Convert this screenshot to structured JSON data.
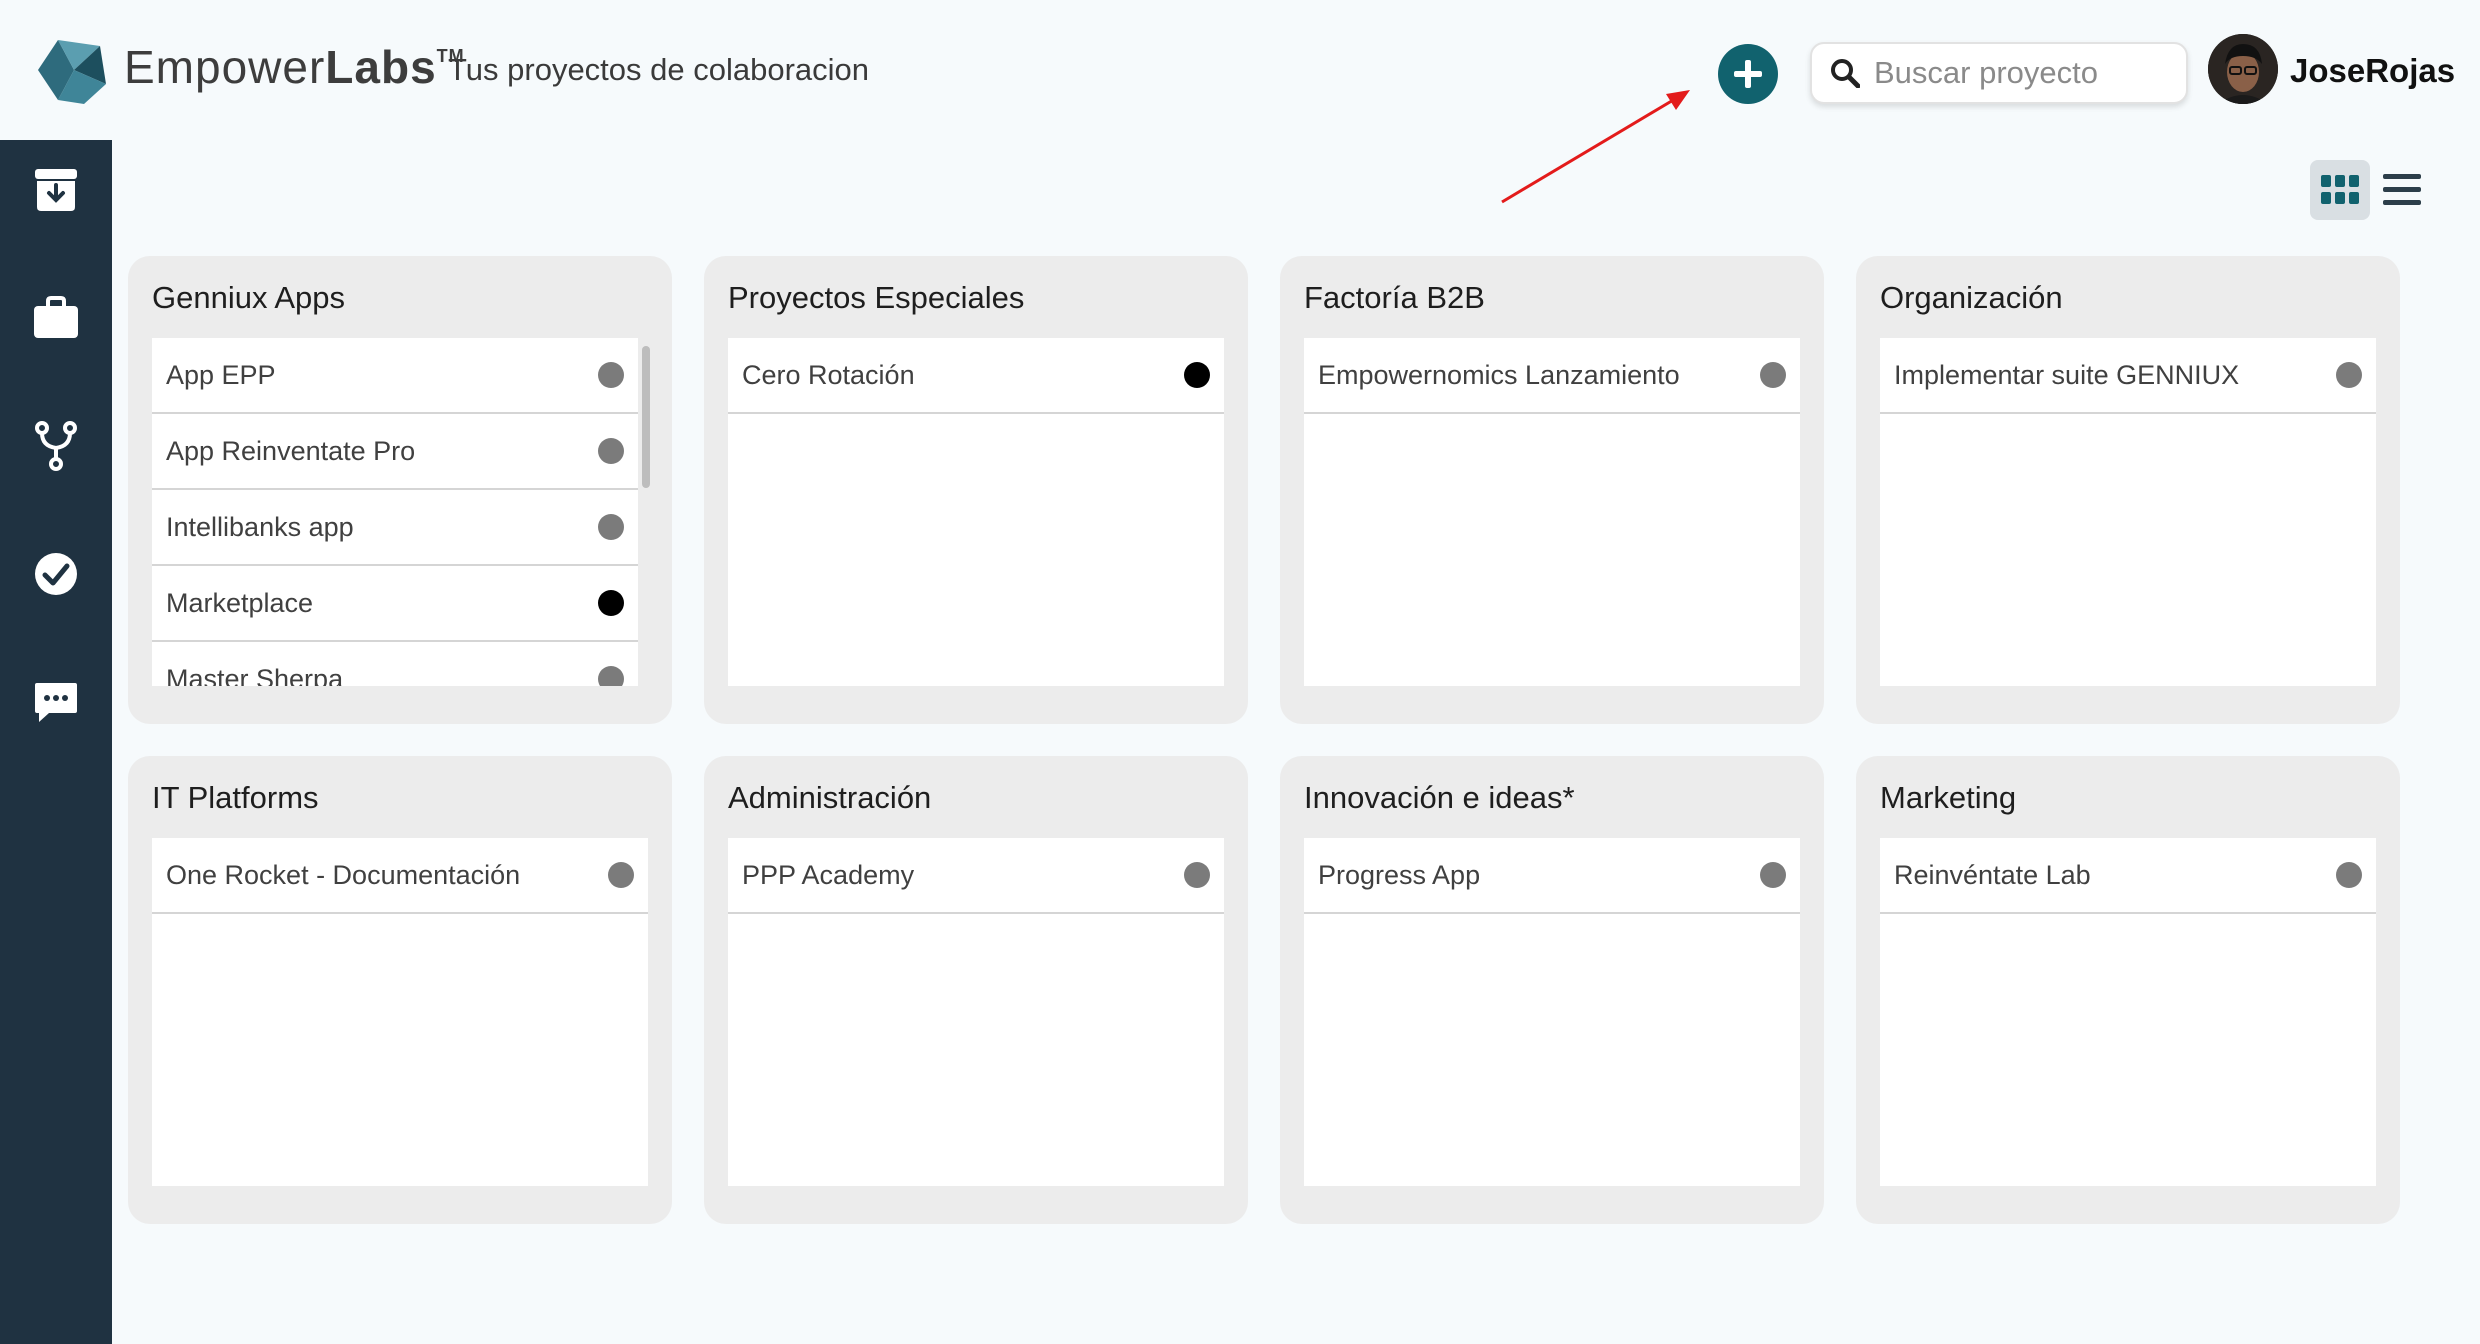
{
  "header": {
    "brand_empower": "Empower",
    "brand_labs": "Labs",
    "brand_tm": "TM",
    "subtitle": "Tus proyectos de colaboracion",
    "search_placeholder": "Buscar proyecto",
    "username": "JoseRojas"
  },
  "colors": {
    "accent": "#11626e",
    "sidebar": "#1f3241",
    "arrow": "#e31b1b"
  },
  "sidebar": {
    "items": [
      {
        "icon": "archive-icon"
      },
      {
        "icon": "briefcase-icon"
      },
      {
        "icon": "branch-icon"
      },
      {
        "icon": "check-circle-icon"
      },
      {
        "icon": "chat-icon"
      }
    ]
  },
  "cards": [
    {
      "title": "Genniux Apps",
      "items": [
        {
          "label": "App EPP",
          "status": "gray"
        },
        {
          "label": "App Reinventate Pro",
          "status": "gray"
        },
        {
          "label": "Intellibanks app",
          "status": "gray"
        },
        {
          "label": "Marketplace",
          "status": "black"
        },
        {
          "label": "Master Sherpa",
          "status": "gray"
        }
      ]
    },
    {
      "title": "Proyectos Especiales",
      "items": [
        {
          "label": "Cero Rotación",
          "status": "black"
        }
      ]
    },
    {
      "title": "Factoría B2B",
      "items": [
        {
          "label": "Empowernomics Lanzamiento",
          "status": "gray"
        }
      ]
    },
    {
      "title": "Organización",
      "items": [
        {
          "label": "Implementar suite GENNIUX",
          "status": "gray"
        }
      ]
    },
    {
      "title": "IT Platforms",
      "items": [
        {
          "label": "One Rocket - Documentación",
          "status": "gray"
        }
      ]
    },
    {
      "title": "Administración",
      "items": [
        {
          "label": "PPP Academy",
          "status": "gray"
        }
      ]
    },
    {
      "title": "Innovación e ideas*",
      "items": [
        {
          "label": "Progress App",
          "status": "gray"
        }
      ]
    },
    {
      "title": "Marketing",
      "items": [
        {
          "label": "Reinvéntate Lab",
          "status": "gray"
        }
      ]
    }
  ]
}
